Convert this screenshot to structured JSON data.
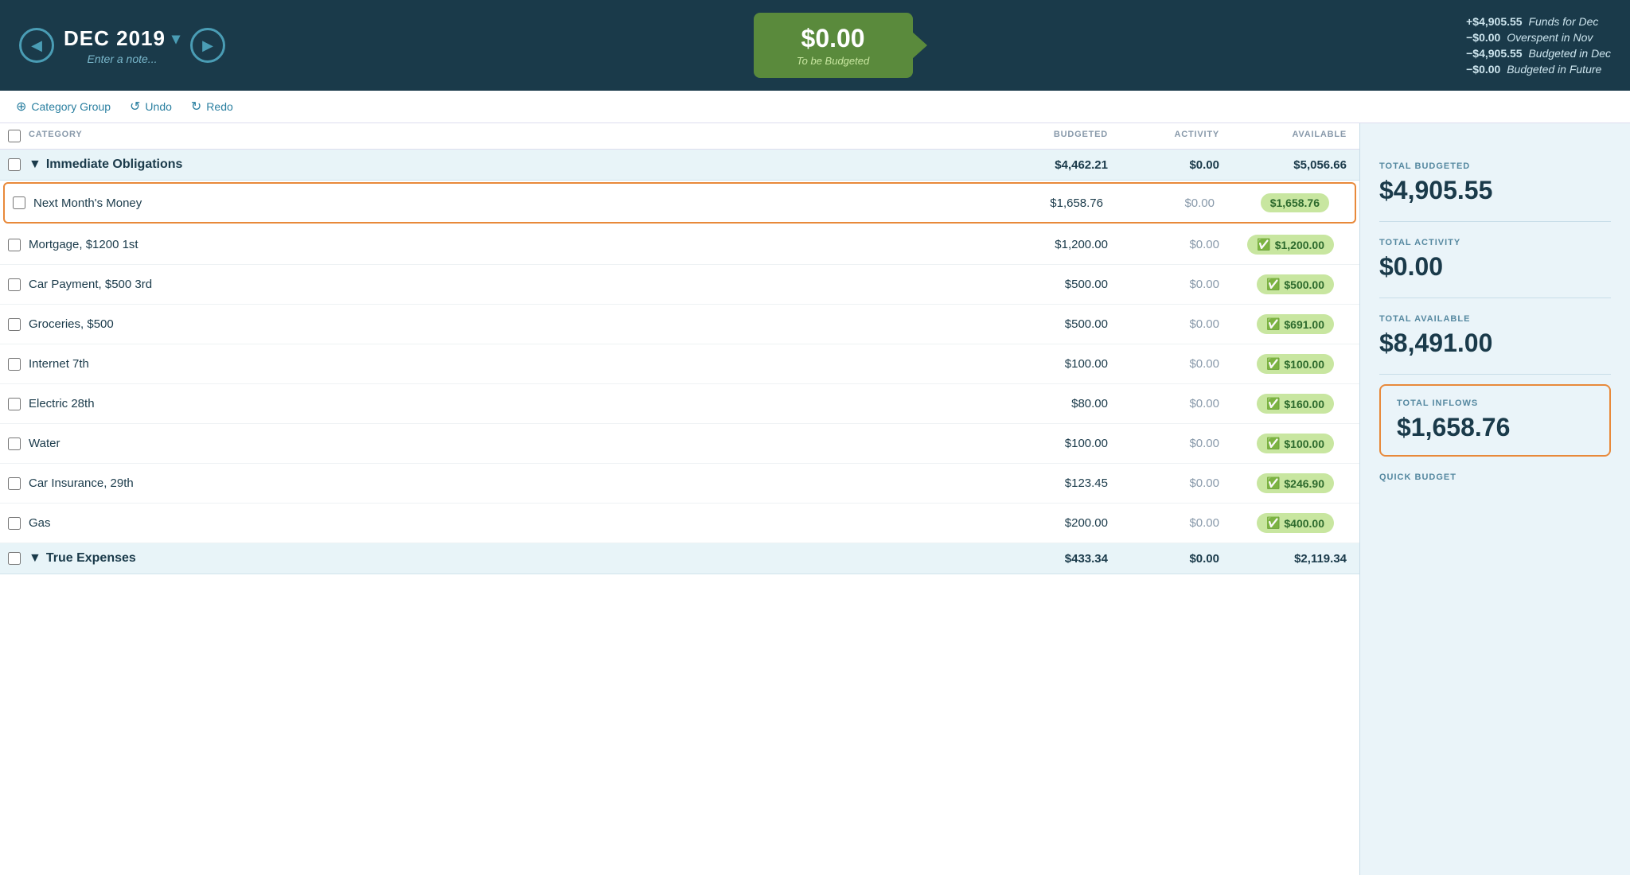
{
  "header": {
    "prev_label": "◀",
    "next_label": "▶",
    "month": "DEC 2019",
    "dropdown_icon": "▾",
    "note_placeholder": "Enter a note...",
    "tbb_amount": "$0.00",
    "tbb_label": "To be Budgeted",
    "breakdown": [
      {
        "amount": "+$4,905.55",
        "desc": "Funds for Dec"
      },
      {
        "amount": "−$0.00",
        "desc": "Overspent in Nov"
      },
      {
        "amount": "−$4,905.55",
        "desc": "Budgeted in Dec"
      },
      {
        "amount": "−$0.00",
        "desc": "Budgeted in Future"
      }
    ]
  },
  "toolbar": {
    "add_group_label": "Category Group",
    "undo_label": "Undo",
    "redo_label": "Redo"
  },
  "table": {
    "headers": {
      "category": "CATEGORY",
      "budgeted": "BUDGETED",
      "activity": "ACTIVITY",
      "available": "AVAILABLE"
    },
    "groups": [
      {
        "name": "Immediate Obligations",
        "budgeted": "$4,462.21",
        "activity": "$0.00",
        "available": "$5,056.66",
        "categories": [
          {
            "name": "Next Month's Money",
            "budgeted": "$1,658.76",
            "activity": "$0.00",
            "available": "$1,658.76",
            "available_badge": false,
            "highlighted": true
          },
          {
            "name": "Mortgage, $1200 1st",
            "budgeted": "$1,200.00",
            "activity": "$0.00",
            "available": "$1,200.00",
            "available_badge": true
          },
          {
            "name": "Car Payment, $500 3rd",
            "budgeted": "$500.00",
            "activity": "$0.00",
            "available": "$500.00",
            "available_badge": true
          },
          {
            "name": "Groceries, $500",
            "budgeted": "$500.00",
            "activity": "$0.00",
            "available": "$691.00",
            "available_badge": true
          },
          {
            "name": "Internet 7th",
            "budgeted": "$100.00",
            "activity": "$0.00",
            "available": "$100.00",
            "available_badge": true
          },
          {
            "name": "Electric 28th",
            "budgeted": "$80.00",
            "activity": "$0.00",
            "available": "$160.00",
            "available_badge": true
          },
          {
            "name": "Water",
            "budgeted": "$100.00",
            "activity": "$0.00",
            "available": "$100.00",
            "available_badge": true
          },
          {
            "name": "Car Insurance, 29th",
            "budgeted": "$123.45",
            "activity": "$0.00",
            "available": "$246.90",
            "available_badge": true
          },
          {
            "name": "Gas",
            "budgeted": "$200.00",
            "activity": "$0.00",
            "available": "$400.00",
            "available_badge": true
          }
        ]
      },
      {
        "name": "True Expenses",
        "budgeted": "$433.34",
        "activity": "$0.00",
        "available": "$2,119.34",
        "categories": []
      }
    ]
  },
  "right_panel": {
    "total_budgeted_label": "TOTAL BUDGETED",
    "total_budgeted_value": "$4,905.55",
    "total_activity_label": "TOTAL ACTIVITY",
    "total_activity_value": "$0.00",
    "total_available_label": "TOTAL AVAILABLE",
    "total_available_value": "$8,491.00",
    "total_inflows_label": "TOTAL INFLOWS",
    "total_inflows_value": "$1,658.76",
    "quick_budget_label": "QUICK BUDGET"
  }
}
